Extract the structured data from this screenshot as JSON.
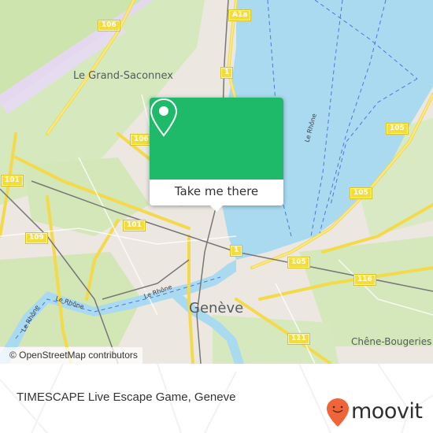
{
  "map": {
    "colors": {
      "water": "#aadaf0",
      "land": "#ece7e1",
      "park": "#cfe6b0",
      "road": "#f7df5e",
      "popup_green": "#1fb96a",
      "moovit_orange": "#f0643a"
    },
    "places": [
      {
        "name": "Le Grand-Saconnex"
      },
      {
        "name": "Genève"
      },
      {
        "name": "Chêne-Bougeries"
      }
    ],
    "rivers": [
      {
        "name": "Le Rhône"
      },
      {
        "name": "Le Rhône"
      },
      {
        "name": "Le Rhône"
      },
      {
        "name": "Le Rhône"
      }
    ],
    "road_shields": [
      {
        "label": "106"
      },
      {
        "label": "A1a"
      },
      {
        "label": "1"
      },
      {
        "label": "106"
      },
      {
        "label": "105"
      },
      {
        "label": "101"
      },
      {
        "label": "101"
      },
      {
        "label": "105"
      },
      {
        "label": "109"
      },
      {
        "label": "1"
      },
      {
        "label": "105"
      },
      {
        "label": "116"
      },
      {
        "label": "111"
      }
    ],
    "attribution": "© OpenStreetMap contributors"
  },
  "popup": {
    "pin_icon": "map-pin-icon",
    "action_label": "Take me there"
  },
  "footer": {
    "title": "TIMESCAPE Live Escape Game, Geneve",
    "brand": "moovit"
  }
}
